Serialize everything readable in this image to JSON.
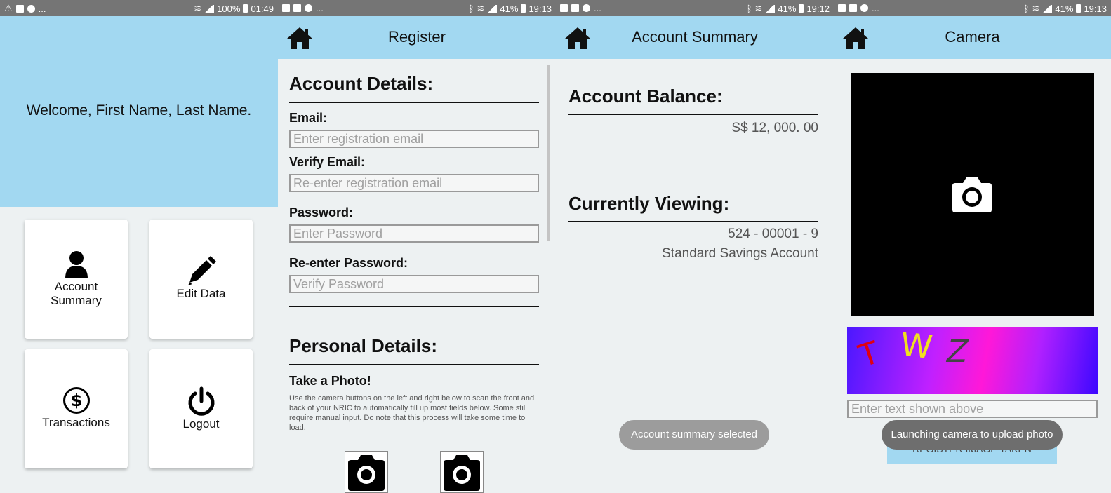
{
  "screen1": {
    "status": {
      "left_icons": "...",
      "battery": "100%",
      "time": "01:49"
    },
    "welcome": "Welcome, First Name, Last Name.",
    "tiles": [
      {
        "label_line1": "Account",
        "label_line2": "Summary",
        "icon": "person-icon"
      },
      {
        "label_line1": "Edit Data",
        "label_line2": "",
        "icon": "pencil-icon"
      },
      {
        "label_line1": "Transactions",
        "label_line2": "",
        "icon": "dollar-icon"
      },
      {
        "label_line1": "Logout",
        "label_line2": "",
        "icon": "power-icon"
      }
    ]
  },
  "screen2": {
    "status": {
      "left_icons": "...",
      "battery": "41%",
      "time": "19:13"
    },
    "title": "Register",
    "account_heading": "Account Details:",
    "email_label": "Email:",
    "email_placeholder": "Enter registration email",
    "verify_email_label": "Verify Email:",
    "verify_email_placeholder": "Re-enter registration email",
    "password_label": "Password:",
    "password_placeholder": "Enter Password",
    "reenter_password_label": "Re-enter Password:",
    "reenter_password_placeholder": "Verify Password",
    "personal_heading": "Personal Details:",
    "photo_heading": "Take a Photo!",
    "photo_help": "Use the camera buttons on the left and right below to scan the front and back of your NRIC to automatically fill up most fields below. Some still require manual input. Do note that this process will take some time to load."
  },
  "screen3": {
    "status": {
      "left_icons": "...",
      "battery": "41%",
      "time": "19:12"
    },
    "title": "Account Summary",
    "balance_heading": "Account Balance:",
    "balance_value": "S$ 12, 000. 00",
    "viewing_heading": "Currently Viewing:",
    "account_number": "524 - 00001 - 9",
    "account_type": "Standard Savings Account",
    "toast": "Account summary selected"
  },
  "screen4": {
    "status": {
      "left_icons": "...",
      "battery": "41%",
      "time": "19:13"
    },
    "title": "Camera",
    "captcha_chars": [
      "T",
      "W",
      "Z"
    ],
    "captcha_placeholder": "Enter text shown above",
    "register_button": "REGISTER IMAGE TAKEN",
    "toast": "Launching camera to upload photo"
  },
  "colors": {
    "appbar": "#a2d8f1",
    "background": "#edf1f2",
    "statusbar": "#757575"
  }
}
